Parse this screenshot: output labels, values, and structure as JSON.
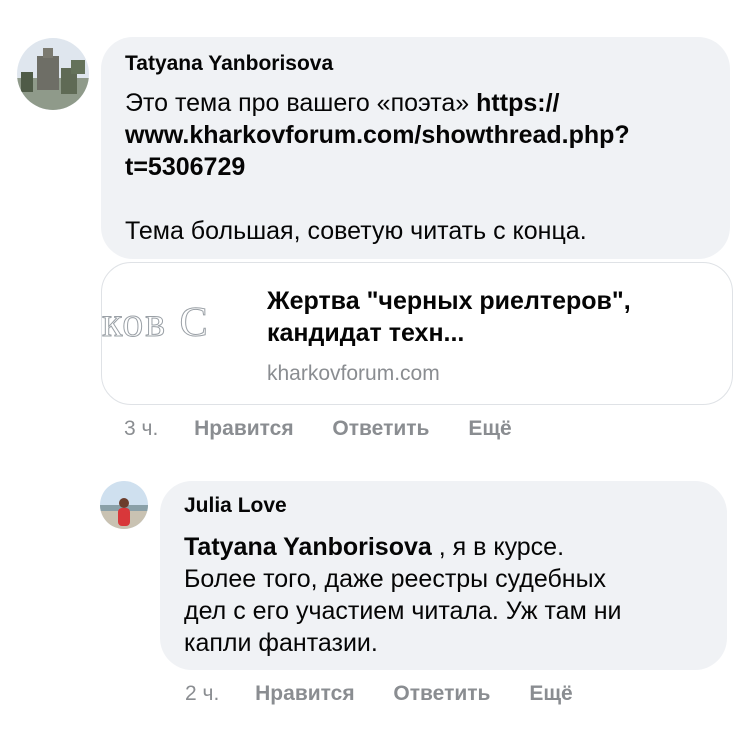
{
  "comment1": {
    "author": "Tatyana Yanborisova",
    "text_plain": "Это тема про вашего «поэта» ",
    "link_line1": "https://",
    "link_line2": "www.kharkovforum.com/showthread.php?",
    "link_line3": "t=5306729",
    "text_after": "Тема большая, советую читать с конца.",
    "preview": {
      "thumb_text": "ков С",
      "title_line1": "Жертва \"черных риелтеров\",",
      "title_line2": "кандидат техн...",
      "domain": "kharkovforum.com"
    },
    "actions": {
      "time": "3 ч.",
      "like": "Нравится",
      "reply": "Ответить",
      "more": "Ещё"
    }
  },
  "comment2": {
    "author": "Julia Love",
    "mention": "Tatyana Yanborisova",
    "line1_rest": " , я в курсе.",
    "line2": "Более того, даже реестры судебных",
    "line3": "дел с его участием читала. Уж там ни",
    "line4": "капли фантазии.",
    "actions": {
      "time": "2 ч.",
      "like": "Нравится",
      "reply": "Ответить",
      "more": "Ещё"
    }
  }
}
